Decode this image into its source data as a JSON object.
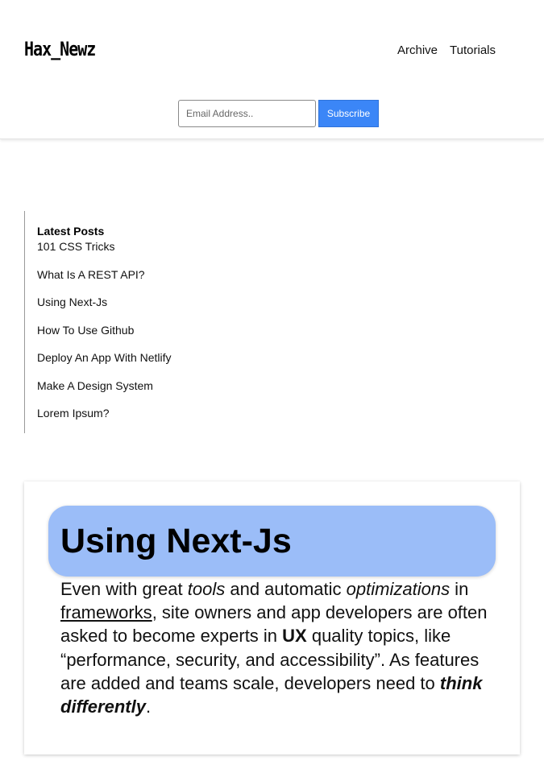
{
  "header": {
    "logo": "Hax_Newz",
    "nav": [
      {
        "label": "Archive"
      },
      {
        "label": "Tutorials"
      }
    ],
    "subscribe": {
      "placeholder": "Email Address..",
      "value": "",
      "button_label": "Subscribe"
    }
  },
  "sidebar": {
    "heading": "Latest Posts",
    "posts": [
      {
        "label": "101 CSS Tricks"
      },
      {
        "label": "What Is A REST API?"
      },
      {
        "label": "Using Next-Js"
      },
      {
        "label": "How To Use Github"
      },
      {
        "label": "Deploy An App With Netlify"
      },
      {
        "label": "Make A Design System"
      },
      {
        "label": "Lorem Ipsum?"
      }
    ]
  },
  "article": {
    "title": "Using Next-Js",
    "body": {
      "p1": "Even with great ",
      "em1": "tools",
      "p2": " and automatic ",
      "em2": "optimizations",
      "p3": " in ",
      "link": "frameworks",
      "p4": ", site owners and app developers are often asked to become experts in ",
      "strong1": "UX",
      "p5": " quality topics, like “performance, security, and accessibility”. As features are added and teams scale, developers need to ",
      "strong_em": "think differently",
      "p6": "."
    }
  },
  "colors": {
    "accent_button": "#3b86f7",
    "title_pill": "#9bbdf8"
  }
}
